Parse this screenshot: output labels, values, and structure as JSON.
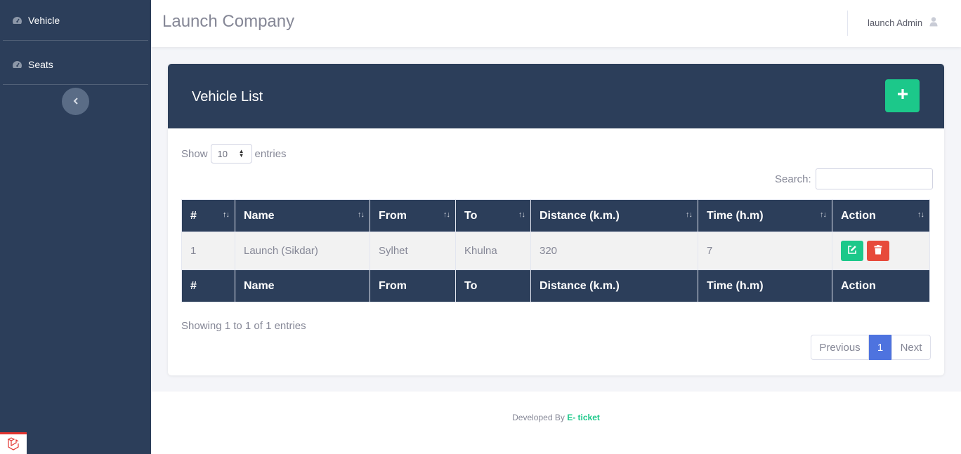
{
  "sidebar": {
    "items": [
      {
        "label": "Vehicle",
        "icon": "tachometer-icon"
      },
      {
        "label": "Seats",
        "icon": "tachometer-icon"
      }
    ],
    "toggle_icon": "chevron-left-icon"
  },
  "topbar": {
    "brand": "Launch Company",
    "user": "launch Admin",
    "user_icon": "user-icon"
  },
  "card": {
    "title": "Vehicle List",
    "add_icon": "plus-icon"
  },
  "table_controls": {
    "show_label": "Show",
    "entries_value": "10",
    "entries_label": "entries",
    "search_label": "Search:",
    "search_value": ""
  },
  "table": {
    "columns": [
      "#",
      "Name",
      "From",
      "To",
      "Distance (k.m.)",
      "Time (h.m)",
      "Action"
    ],
    "rows": [
      {
        "num": "1",
        "name": "Launch (Sikdar)",
        "from": "Sylhet",
        "to": "Khulna",
        "distance": "320",
        "time": "7"
      }
    ],
    "actions": {
      "edit_icon": "edit-icon",
      "delete_icon": "trash-icon"
    }
  },
  "pagination": {
    "info": "Showing 1 to 1 of 1 entries",
    "previous": "Previous",
    "current": "1",
    "next": "Next"
  },
  "footer": {
    "prefix": "Developed By",
    "brand": "E- ticket"
  },
  "colors": {
    "sidebar": "#2c3e5a",
    "success": "#1cc88a",
    "danger": "#e74a3b",
    "primary": "#4e73df"
  }
}
